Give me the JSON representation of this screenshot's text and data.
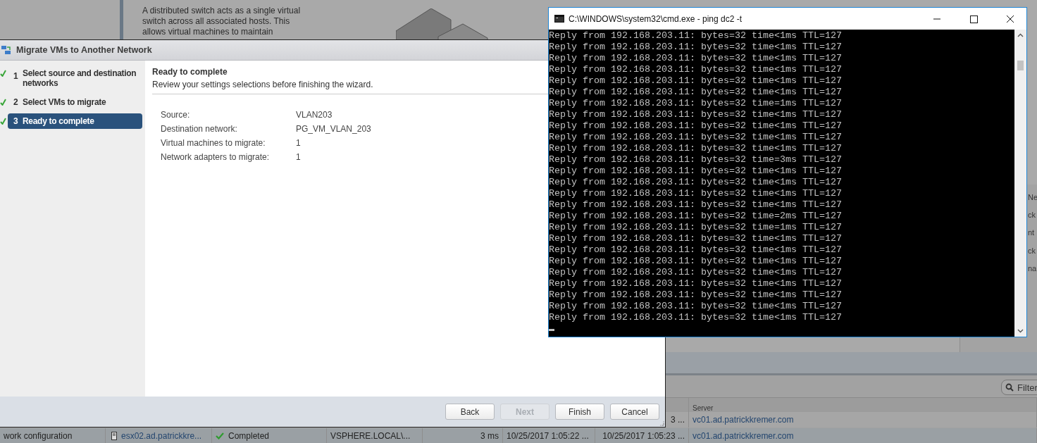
{
  "background": {
    "description_lines": [
      "A distributed switch acts as a single virtual",
      "switch across all associated hosts. This",
      "allows virtual machines to maintain"
    ],
    "side_panel_texts": [
      "Ne",
      "ck",
      "nt",
      "ck",
      "na"
    ],
    "filter": {
      "placeholder": "Filter"
    },
    "table": {
      "columns": [
        "",
        "",
        "",
        "",
        "",
        "",
        "",
        "Server"
      ],
      "rows": [
        {
          "cells": [
            "",
            "",
            "",
            "",
            "",
            "",
            "3 ...",
            "vc01.ad.patrickkremer.com"
          ]
        },
        {
          "cells": [
            "work configuration",
            "esx02.ad.patrickkre...",
            "Completed",
            "VSPHERE.LOCAL\\...",
            "3 ms",
            "10/25/2017 1:05:22 ...",
            "10/25/2017 1:05:23 ...",
            "vc01.ad.patrickkremer.com"
          ]
        }
      ]
    }
  },
  "wizard": {
    "title": "Migrate VMs to Another Network",
    "steps": [
      {
        "number": "1",
        "label": "Select source and destination networks",
        "completed": true,
        "selected": false
      },
      {
        "number": "2",
        "label": "Select VMs to migrate",
        "completed": true,
        "selected": false
      },
      {
        "number": "3",
        "label": "Ready to complete",
        "completed": true,
        "selected": true
      }
    ],
    "heading": "Ready to complete",
    "subheading": "Review your settings selections before finishing the wizard.",
    "summary": [
      {
        "label": "Source:",
        "value": "VLAN203"
      },
      {
        "label": "Destination network:",
        "value": "PG_VM_VLAN_203"
      },
      {
        "label": "Virtual machines to migrate:",
        "value": "1"
      },
      {
        "label": "Network adapters to migrate:",
        "value": "1"
      }
    ],
    "buttons": [
      {
        "label": "Back",
        "disabled": false
      },
      {
        "label": "Next",
        "disabled": true
      },
      {
        "label": "Finish",
        "disabled": false
      },
      {
        "label": "Cancel",
        "disabled": false
      }
    ]
  },
  "console": {
    "title": "C:\\WINDOWS\\system32\\cmd.exe - ping  dc2 -t",
    "lines": [
      "Reply from 192.168.203.11: bytes=32 time<1ms TTL=127",
      "Reply from 192.168.203.11: bytes=32 time<1ms TTL=127",
      "Reply from 192.168.203.11: bytes=32 time<1ms TTL=127",
      "Reply from 192.168.203.11: bytes=32 time<1ms TTL=127",
      "Reply from 192.168.203.11: bytes=32 time<1ms TTL=127",
      "Reply from 192.168.203.11: bytes=32 time<1ms TTL=127",
      "Reply from 192.168.203.11: bytes=32 time=1ms TTL=127",
      "Reply from 192.168.203.11: bytes=32 time<1ms TTL=127",
      "Reply from 192.168.203.11: bytes=32 time<1ms TTL=127",
      "Reply from 192.168.203.11: bytes=32 time<1ms TTL=127",
      "Reply from 192.168.203.11: bytes=32 time<1ms TTL=127",
      "Reply from 192.168.203.11: bytes=32 time=3ms TTL=127",
      "Reply from 192.168.203.11: bytes=32 time<1ms TTL=127",
      "Reply from 192.168.203.11: bytes=32 time<1ms TTL=127",
      "Reply from 192.168.203.11: bytes=32 time<1ms TTL=127",
      "Reply from 192.168.203.11: bytes=32 time<1ms TTL=127",
      "Reply from 192.168.203.11: bytes=32 time=2ms TTL=127",
      "Reply from 192.168.203.11: bytes=32 time=1ms TTL=127",
      "Reply from 192.168.203.11: bytes=32 time<1ms TTL=127",
      "Reply from 192.168.203.11: bytes=32 time<1ms TTL=127",
      "Reply from 192.168.203.11: bytes=32 time<1ms TTL=127",
      "Reply from 192.168.203.11: bytes=32 time<1ms TTL=127",
      "Reply from 192.168.203.11: bytes=32 time<1ms TTL=127",
      "Reply from 192.168.203.11: bytes=32 time<1ms TTL=127",
      "Reply from 192.168.203.11: bytes=32 time<1ms TTL=127",
      "Reply from 192.168.203.11: bytes=32 time<1ms TTL=127"
    ]
  }
}
